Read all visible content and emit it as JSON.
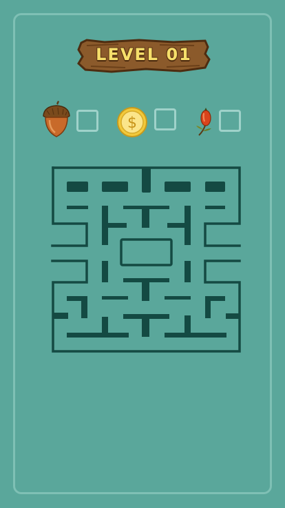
{
  "level": {
    "title": "LEVEL 01"
  },
  "goals": [
    {
      "name": "acorn",
      "icon": "acorn-icon",
      "collected": false
    },
    {
      "name": "coin",
      "icon": "dollar-coin-icon",
      "coin_symbol": "$",
      "collected": false
    },
    {
      "name": "berry",
      "icon": "rosehip-berry-icon",
      "collected": false
    }
  ],
  "colors": {
    "background": "#5aa79b",
    "maze_wall": "#144a43",
    "panel_border": "#7fc0b5",
    "goal_box_border": "#9fd2ca",
    "sign_wood": "#8b5a2b",
    "title_text": "#f6df6b",
    "coin_gold": "#f3c93b"
  }
}
